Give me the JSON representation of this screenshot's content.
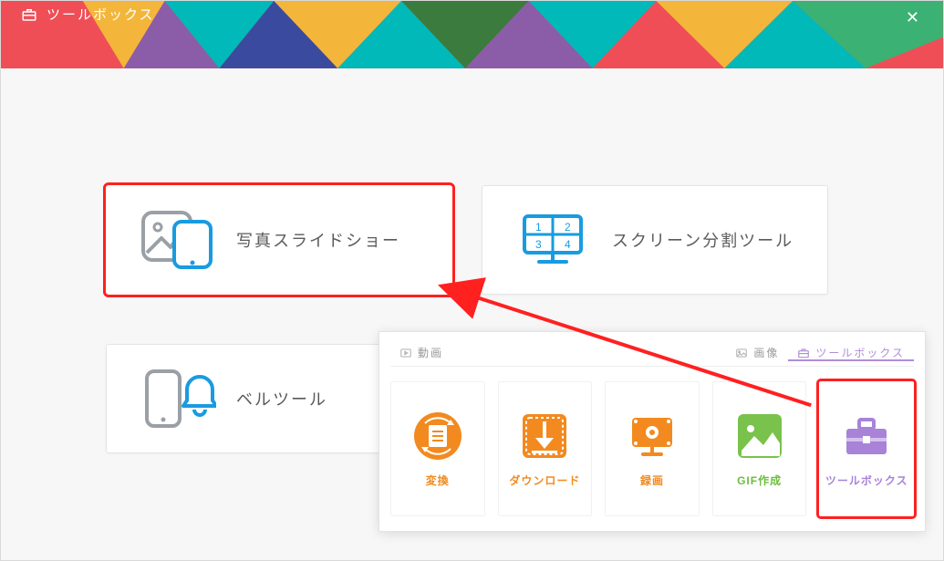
{
  "window": {
    "title": "ツールボックス"
  },
  "cards": {
    "slideshow": {
      "label": "写真スライドショー"
    },
    "splitter": {
      "label": "スクリーン分割ツール"
    },
    "belltool": {
      "label": "ベルツール"
    }
  },
  "panel": {
    "tabs": {
      "video": {
        "label": "動画"
      },
      "image": {
        "label": "画像"
      },
      "toolbox": {
        "label": "ツールボックス"
      }
    },
    "tiles": {
      "convert": {
        "label": "変換"
      },
      "download": {
        "label": "ダウンロード"
      },
      "record": {
        "label": "録画"
      },
      "gif": {
        "label": "GIF作成"
      },
      "toolbox": {
        "label": "ツールボックス"
      }
    }
  }
}
